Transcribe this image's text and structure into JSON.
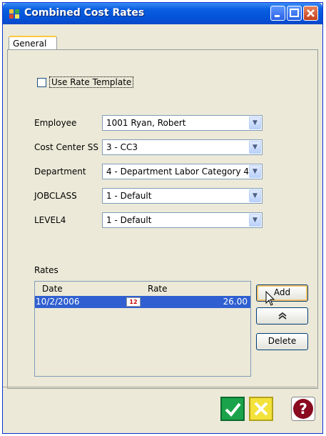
{
  "window": {
    "title": "Combined Cost Rates"
  },
  "tabs": [
    {
      "label": "General",
      "active": true
    }
  ],
  "use_rate_template": {
    "label": "Use Rate Template",
    "checked": false
  },
  "fields": [
    {
      "label": "Employee",
      "value": "1001 Ryan, Robert"
    },
    {
      "label": "Cost Center SS",
      "value": "3 - CC3"
    },
    {
      "label": "Department",
      "value": "4 - Department Labor Category 4"
    },
    {
      "label": "JOBCLASS",
      "value": "1 - Default"
    },
    {
      "label": "LEVEL4",
      "value": "1 - Default"
    }
  ],
  "rates": {
    "label": "Rates",
    "columns": [
      "Date",
      "Rate"
    ],
    "rows": [
      {
        "date": "10/2/2006",
        "rate": "26.00"
      }
    ],
    "buttons": {
      "add": "Add",
      "delete": "Delete"
    }
  },
  "icons": {
    "app": "app-icon",
    "calendar": "calendar-icon",
    "move_up": "double-chevron-up-icon",
    "ok": "checkmark-icon",
    "cancel": "x-icon",
    "help": "question-mark-icon"
  },
  "colors": {
    "titlebar": "#0453d8",
    "selection": "#2f5fd0",
    "ok": "#1aa34a",
    "cancel": "#f3e23a",
    "help": "#8a0a1f"
  }
}
